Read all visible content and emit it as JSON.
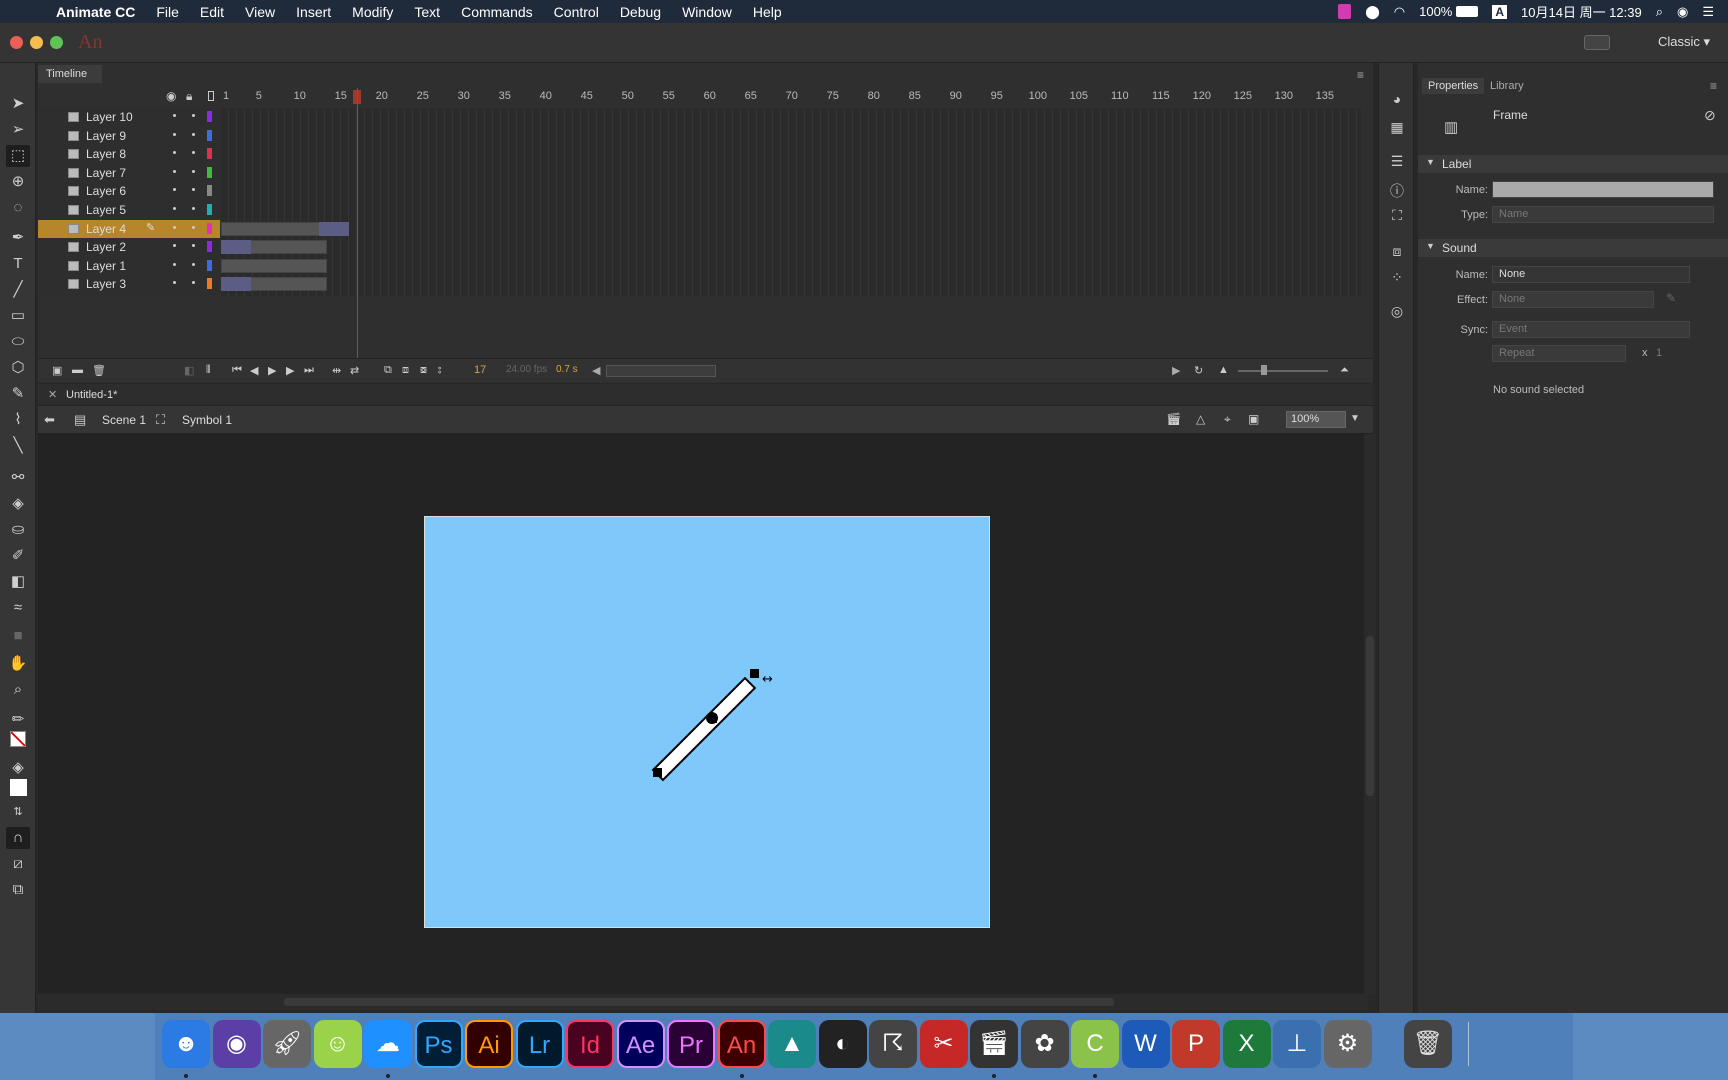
{
  "menubar": {
    "app": "Animate CC",
    "items": [
      "File",
      "Edit",
      "View",
      "Insert",
      "Modify",
      "Text",
      "Commands",
      "Control",
      "Debug",
      "Window",
      "Help"
    ],
    "battery": "100%",
    "input": "A",
    "datetime": "10月14日 周一 12:39"
  },
  "title": {
    "logo": "An",
    "workspace": "Classic ▾"
  },
  "timeline": {
    "tab": "Timeline",
    "ruler": [
      "1",
      "5",
      "10",
      "15",
      "20",
      "25",
      "30",
      "35",
      "40",
      "45",
      "50",
      "55",
      "60",
      "65",
      "70",
      "75",
      "80",
      "85",
      "90",
      "95",
      "100",
      "105",
      "110",
      "115",
      "120",
      "125",
      "130",
      "135"
    ],
    "layers": [
      {
        "name": "Layer 10",
        "color": "#8a2be2"
      },
      {
        "name": "Layer 9",
        "color": "#3d6be0"
      },
      {
        "name": "Layer 8",
        "color": "#e0304a"
      },
      {
        "name": "Layer 7",
        "color": "#3dbd3d"
      },
      {
        "name": "Layer 6",
        "color": "#888888"
      },
      {
        "name": "Layer 5",
        "color": "#20b0b0"
      },
      {
        "name": "Layer 4",
        "color": "#e030c0",
        "active": true
      },
      {
        "name": "Layer 2",
        "color": "#8a2be2"
      },
      {
        "name": "Layer 1",
        "color": "#3d6be0"
      },
      {
        "name": "Layer 3",
        "color": "#f07a20"
      }
    ],
    "current_frame": "17",
    "fps": "24.00 fps",
    "time": "0.7 s"
  },
  "document": {
    "tab": "Untitled-1*",
    "scene": "Scene 1",
    "symbol": "Symbol 1",
    "zoom": "100%"
  },
  "properties": {
    "tabs": [
      "Properties",
      "Library"
    ],
    "object": "Frame",
    "label_section": "Label",
    "name_label": "Name:",
    "type_label": "Type:",
    "type_value": "Name",
    "sound_section": "Sound",
    "sound_name_label": "Name:",
    "sound_name_value": "None",
    "effect_label": "Effect:",
    "effect_value": "None",
    "sync_label": "Sync:",
    "sync_value": "Event",
    "repeat_value": "Repeat",
    "repeat_x": "x",
    "repeat_count": "1",
    "no_sound": "No sound selected"
  },
  "dock": [
    "Finder",
    "Siri",
    "Launchpad",
    "Android",
    "QQ",
    "Ps",
    "Ai",
    "Lr",
    "Id",
    "Ae",
    "Pr",
    "An",
    "Maya",
    "Cinema",
    "Character",
    "Stencil",
    "Final Cut",
    "DaVinci",
    "Coda",
    "W",
    "P",
    "X",
    "Keynote",
    "System Preferences",
    "Trash"
  ]
}
